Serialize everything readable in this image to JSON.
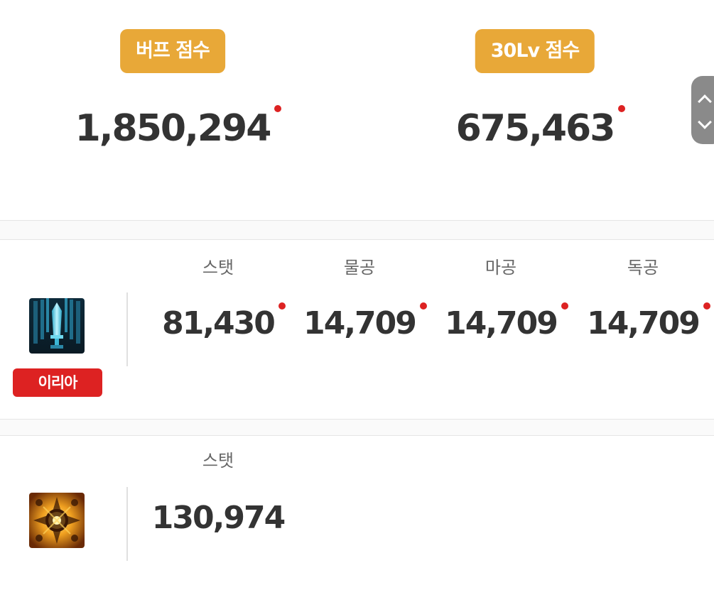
{
  "scores": {
    "buff": {
      "label": "버프 점수",
      "value": "1,850,294",
      "has_indicator": true
    },
    "lv30": {
      "label": "30Lv 점수",
      "value": "675,463",
      "has_indicator": true
    }
  },
  "scroll_control": {
    "up_icon": "chevron-up-icon",
    "down_icon": "chevron-down-icon"
  },
  "rows": [
    {
      "icon": "sword-skill-icon",
      "character_badge": "이리아",
      "stats": [
        {
          "label": "스탯",
          "value": "81,430",
          "has_indicator": true
        },
        {
          "label": "물공",
          "value": "14,709",
          "has_indicator": true
        },
        {
          "label": "마공",
          "value": "14,709",
          "has_indicator": true
        },
        {
          "label": "독공",
          "value": "14,709",
          "has_indicator": true
        }
      ]
    },
    {
      "icon": "aura-skill-icon",
      "stats": [
        {
          "label": "스탯",
          "value": "130,974",
          "has_indicator": false
        }
      ]
    }
  ],
  "colors": {
    "badge_orange": "#e8a838",
    "badge_red": "#dd2222",
    "indicator_red": "#dd2222",
    "text_dark": "#333333",
    "text_label": "#666666",
    "scroll_gray": "#8a8a8a"
  }
}
